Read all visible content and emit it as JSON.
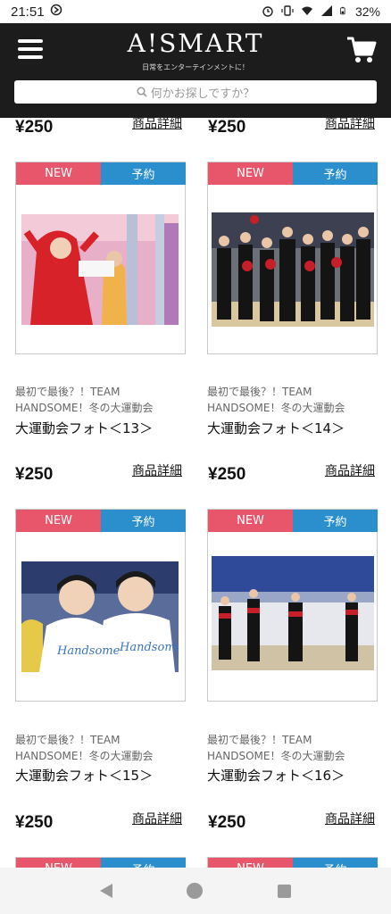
{
  "status_bar": {
    "time": "21:51",
    "battery": "32%"
  },
  "header": {
    "logo": "A!SMART",
    "tagline": "日常をエンターテインメントに！",
    "search_placeholder": "何かお探しですか？"
  },
  "top_row": {
    "left": {
      "price": "¥250",
      "detail_label": "商品詳細"
    },
    "right": {
      "price": "¥250",
      "detail_label": "商品詳細"
    }
  },
  "products": [
    {
      "badge_new": "NEW",
      "badge_reserve": "予約",
      "subtitle": "最初で最後？！TEAM HANDSOME！冬の大運動会",
      "title": "大運動会フォト＜13＞",
      "price": "¥250",
      "detail_label": "商品詳細"
    },
    {
      "badge_new": "NEW",
      "badge_reserve": "予約",
      "subtitle": "最初で最後？！TEAM HANDSOME！冬の大運動会",
      "title": "大運動会フォト＜14＞",
      "price": "¥250",
      "detail_label": "商品詳細"
    },
    {
      "badge_new": "NEW",
      "badge_reserve": "予約",
      "subtitle": "最初で最後？！TEAM HANDSOME！冬の大運動会",
      "title": "大運動会フォト＜15＞",
      "price": "¥250",
      "detail_label": "商品詳細"
    },
    {
      "badge_new": "NEW",
      "badge_reserve": "予約",
      "subtitle": "最初で最後？！TEAM HANDSOME！冬の大運動会",
      "title": "大運動会フォト＜16＞",
      "price": "¥250",
      "detail_label": "商品詳細"
    }
  ],
  "next_row": {
    "badge_new": "NEW",
    "badge_reserve": "予約"
  },
  "photo_text": {
    "shirt_left": "Handsome",
    "shirt_right": "Handsome"
  },
  "colors": {
    "header_bg": "#1c1c1c",
    "badge_new": "#e8566b",
    "badge_reserve": "#2b8fcd"
  },
  "icons": {
    "menu": "hamburger-icon",
    "cart": "cart-icon",
    "search": "search-icon"
  }
}
